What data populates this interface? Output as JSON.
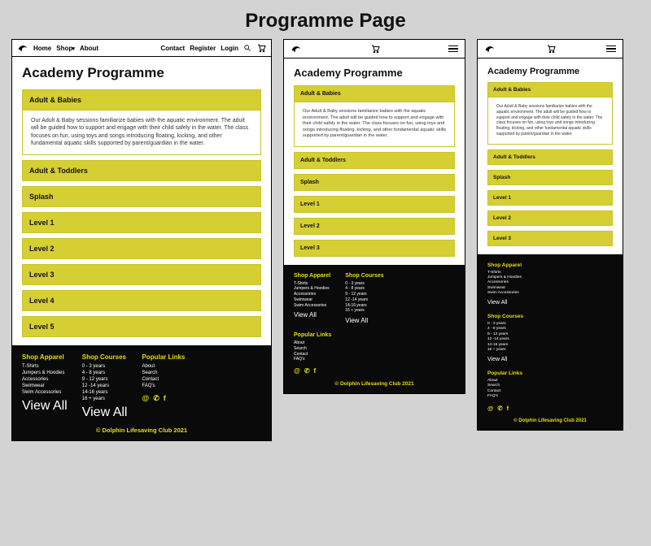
{
  "pageTitle": "Programme Page",
  "heading": "Academy Programme",
  "nav": {
    "home": "Home",
    "shop": "Shop",
    "about": "About",
    "contact": "Contact",
    "register": "Register",
    "login": "Login"
  },
  "accordion": {
    "open": {
      "title": "Adult & Babies",
      "body": "Our Adult & Baby sessions familiarize babies with the aquatic environment. The adult will be guided how to support and engage with their child safely in the water. The class focuses on fun, using toys and songs introducing floating, kicking, and other fundamental aquatic skills supported by parent/guardian in the water."
    },
    "rest": [
      "Adult & Toddlers",
      "Splash",
      "Level 1",
      "Level 2",
      "Level 3",
      "Level 4",
      "Level 5"
    ],
    "restShort": [
      "Adult & Toddlers",
      "Splash",
      "Level 1",
      "Level 2",
      "Level 3"
    ]
  },
  "footer": {
    "apparel": {
      "title": "Shop Apparel",
      "items": [
        "T-Shirts",
        "Jumpers & Hoodies",
        "Accessories",
        "Swimwear",
        "Swim Accessories"
      ],
      "viewAll": "View All"
    },
    "courses": {
      "title": "Shop Courses",
      "items": [
        "0 - 3 years",
        "4 - 8 years",
        "9 - 12 years",
        "12 -14 years",
        "14-16 years",
        "16 + years"
      ],
      "viewAll": "View All"
    },
    "popular": {
      "title": "Popular Links",
      "items": [
        "About",
        "Search",
        "Contact",
        "FAQ's"
      ]
    },
    "copyright": "© Dolphin Lifesaving Club 2021"
  }
}
